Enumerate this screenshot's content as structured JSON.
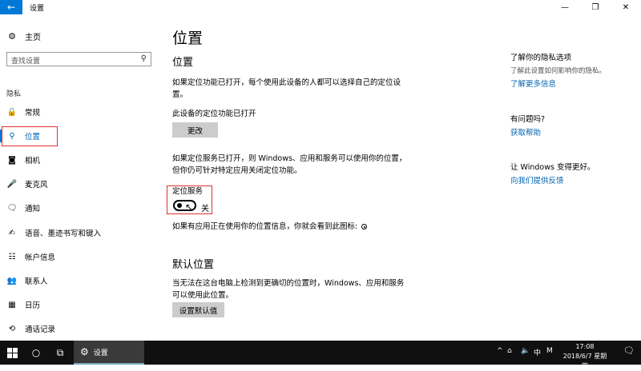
{
  "window": {
    "title": "设置",
    "back_icon": "←",
    "minimize_icon": "—",
    "maximize_icon": "❐",
    "close_icon": "✕"
  },
  "sidebar": {
    "home_label": "主页",
    "search_placeholder": "查找设置",
    "section_label": "隐私",
    "items": [
      {
        "label": "常规",
        "icon": "🔒"
      },
      {
        "label": "位置",
        "icon": "⚲"
      },
      {
        "label": "相机",
        "icon": "◙"
      },
      {
        "label": "麦克风",
        "icon": "🎤"
      },
      {
        "label": "通知",
        "icon": "🗨"
      },
      {
        "label": "语音、墨迹书写和键入",
        "icon": "✍"
      },
      {
        "label": "帐户信息",
        "icon": "☷"
      },
      {
        "label": "联系人",
        "icon": "👥"
      },
      {
        "label": "日历",
        "icon": "▦"
      },
      {
        "label": "通话记录",
        "icon": "⟲"
      }
    ],
    "active_index": 1
  },
  "main": {
    "page_title": "位置",
    "section1_heading": "位置",
    "para1": "如果定位功能已打开，每个使用此设备的人都可以选择自己的定位设置。",
    "device_status": "此设备的定位功能已打开",
    "change_button": "更改",
    "para2": "如果定位服务已打开，则 Windows、应用和服务可以使用你的位置，但你仍可针对特定应用关闭定位功能。",
    "location_service_label": "定位服务",
    "toggle_state": "关",
    "toggle_on": false,
    "icon_note": "如果有应用正在使用你的位置信息，你就会看到此图标:",
    "section2_heading": "默认位置",
    "para3": "当无法在这台电脑上检测到更确切的位置时，Windows、应用和服务可以使用此位置。",
    "set_default_button": "设置默认值"
  },
  "right": {
    "privacy_heading": "了解你的隐私选项",
    "privacy_text": "了解此设置如何影响你的隐私。",
    "learn_more": "了解更多信息",
    "question_heading": "有问题吗?",
    "get_help": "获取帮助",
    "improve_heading": "让 Windows 变得更好。",
    "feedback": "向我们提供反馈"
  },
  "taskbar": {
    "app_label": "设置",
    "time": "17:08",
    "date": "2018/6/7 星期四",
    "ime": "中",
    "ime_mode": "M"
  }
}
